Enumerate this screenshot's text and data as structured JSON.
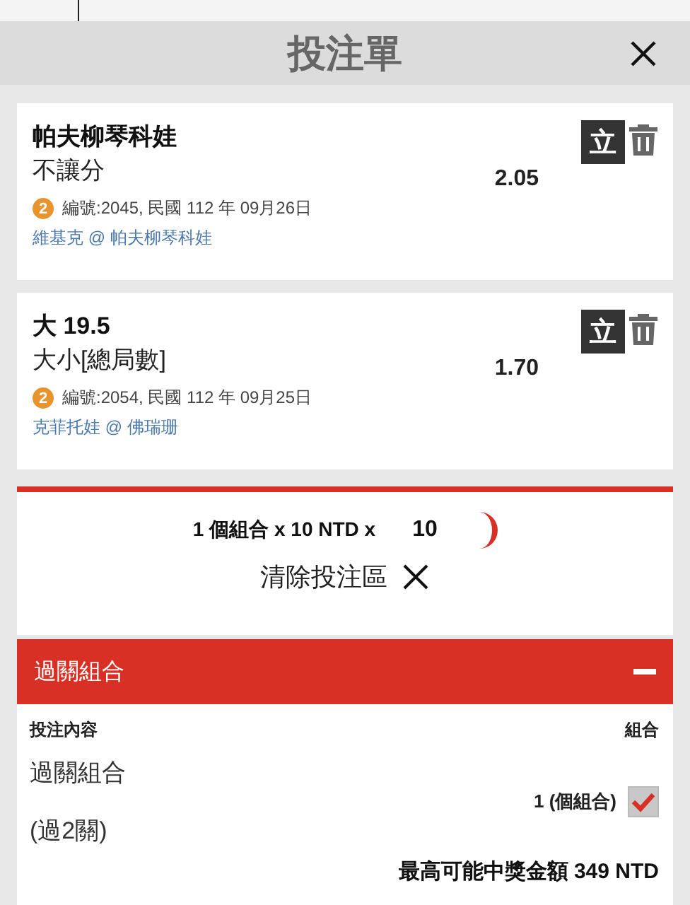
{
  "header": {
    "title": "投注單"
  },
  "bets": [
    {
      "selection": "帕夫柳琴科娃",
      "market": "不讓分",
      "odds": "2.05",
      "badge": "立",
      "count": "2",
      "info": "編號:2045, 民國 112 年 09月26日",
      "match": "維基克 @ 帕夫柳琴科娃"
    },
    {
      "selection": "大 19.5",
      "market": "大小[總局數]",
      "odds": "1.70",
      "badge": "立",
      "count": "2",
      "info": "編號:2054, 民國 112 年 09月25日",
      "match": "克菲托娃 @ 佛瑞珊"
    }
  ],
  "stake": {
    "summary": "1 個組合 x 10 NTD x",
    "value": "10",
    "clear_label": "清除投注區"
  },
  "parlay": {
    "title": "過關組合",
    "expanded": true,
    "columns": [
      "投注內容",
      "組合"
    ],
    "rows": [
      {
        "name": "過關組合",
        "legs": "(過2關)",
        "count": "1 (個組合)",
        "checked": true
      }
    ],
    "max_payout": "最高可能中獎金額 349 NTD"
  }
}
